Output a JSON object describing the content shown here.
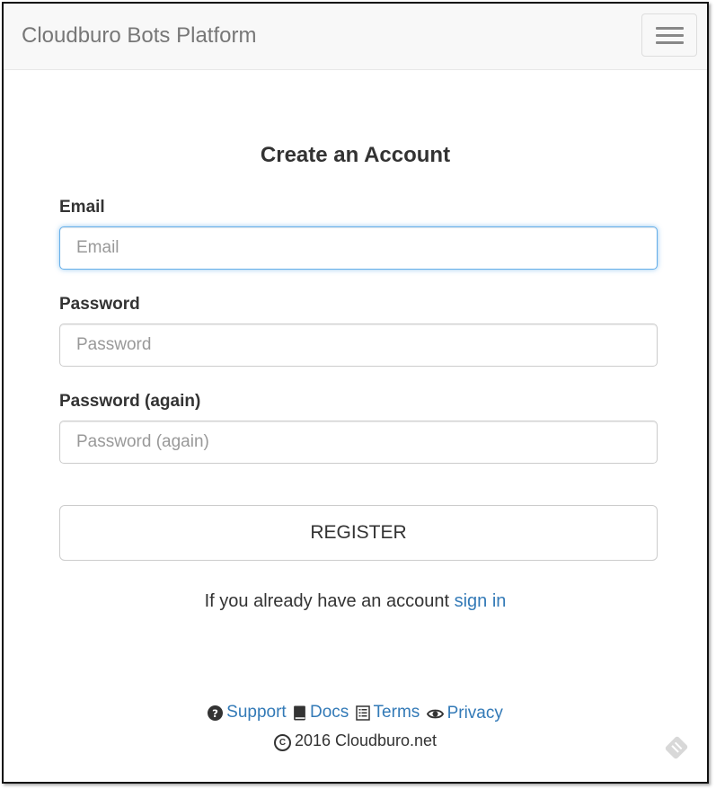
{
  "navbar": {
    "brand": "Cloudburo Bots Platform",
    "menu_icon": "hamburger-menu-icon"
  },
  "form": {
    "title": "Create an Account",
    "email": {
      "label": "Email",
      "placeholder": "Email",
      "value": ""
    },
    "password": {
      "label": "Password",
      "placeholder": "Password",
      "value": ""
    },
    "password_again": {
      "label": "Password (again)",
      "placeholder": "Password (again)",
      "value": ""
    },
    "register_label": "REGISTER",
    "signin_prompt": "If you already have an account",
    "signin_link": "sign in"
  },
  "footer": {
    "links": [
      {
        "label": "Support",
        "icon": "question-circle-icon"
      },
      {
        "label": "Docs",
        "icon": "book-icon"
      },
      {
        "label": "Terms",
        "icon": "list-document-icon"
      },
      {
        "label": "Privacy",
        "icon": "eye-icon"
      }
    ],
    "copyright": "2016 Cloudburo.net"
  },
  "colors": {
    "link": "#337ab7",
    "navbar_bg": "#f8f8f8",
    "focus_border": "#66afe9",
    "text": "#333333"
  }
}
